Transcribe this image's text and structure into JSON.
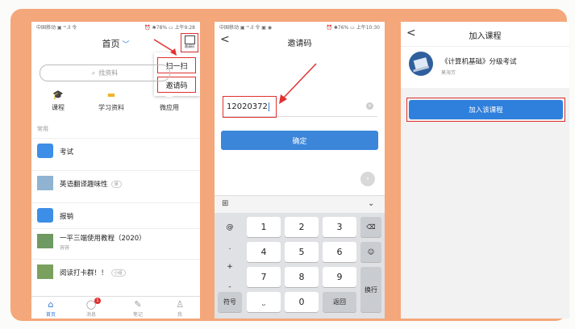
{
  "colors": {
    "accent": "#2f79d6",
    "highlight": "#e03030",
    "frame": "#f4a77a"
  },
  "phone1": {
    "status_left": "中国移动 ▣ ᵐ.il 令",
    "status_right": "⏰ ✱78% ▭ 上午9:28",
    "title": "首页",
    "scan_label": "邀请码",
    "menu": [
      "扫一扫",
      "邀请码"
    ],
    "search_placeholder": "找资料",
    "grid": [
      {
        "label": "课程",
        "icon": "graduation-cap-icon"
      },
      {
        "label": "学习资料",
        "icon": "folder-icon"
      },
      {
        "label": "微应用",
        "icon": "app-icon"
      }
    ],
    "section": "常用",
    "rows": [
      {
        "label": "考试",
        "sub": "",
        "badge": ""
      },
      {
        "label": "英语翻译趣味性",
        "sub": "",
        "badge": "课"
      },
      {
        "label": "报销",
        "sub": "",
        "badge": ""
      },
      {
        "label": "一平三端使用教程（2020）",
        "sub": "容容",
        "badge": ""
      },
      {
        "label": "阅读打卡群！！",
        "sub": "",
        "badge": "小组"
      }
    ],
    "tabs": [
      {
        "label": "首页"
      },
      {
        "label": "消息",
        "badge": "1"
      },
      {
        "label": "笔记"
      },
      {
        "label": "我"
      }
    ]
  },
  "phone2": {
    "status_left": "中国移动 ▣ ᵐ.il 令 ▣ ◉",
    "status_right": "⏰ ✱76% ▭ 上午10:30",
    "back": "<",
    "title": "邀请码",
    "code": "12020372",
    "confirm": "确定",
    "keys": {
      "side": [
        "@",
        ".",
        "+",
        "-"
      ],
      "digits": [
        "1",
        "2",
        "3",
        "4",
        "5",
        "6",
        "7",
        "8",
        "9",
        "0"
      ],
      "symbol": "符号",
      "back": "返回",
      "newline": "换行"
    }
  },
  "phone3": {
    "back": "<",
    "title": "加入课程",
    "course_title": "《计算机基础》分级考试",
    "course_author": "莫海芳",
    "join": "加入该课程"
  }
}
